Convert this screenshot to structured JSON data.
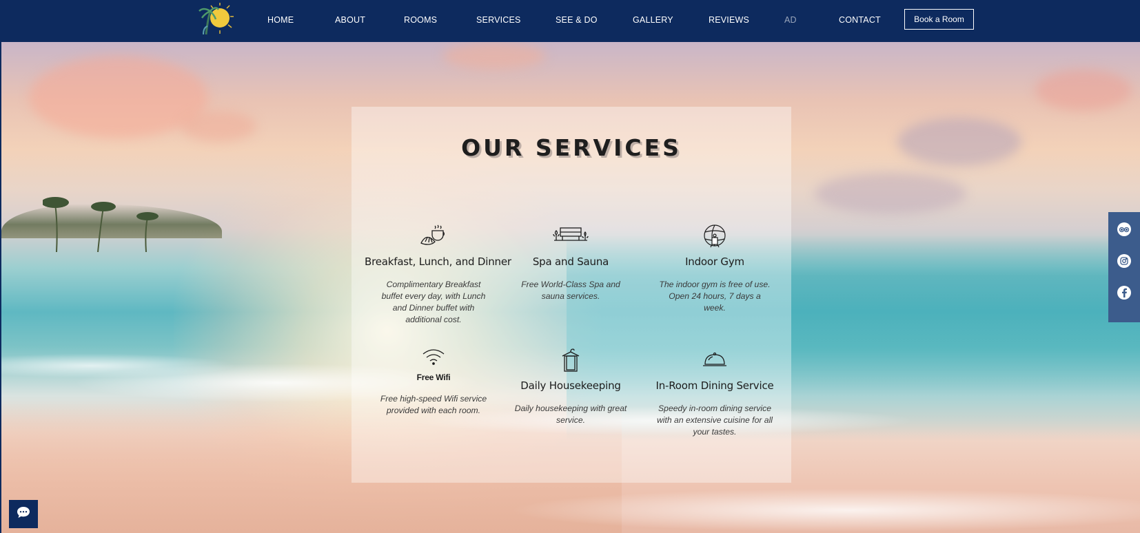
{
  "header": {
    "logo_alt": "Palms & Sun logo",
    "nav": [
      {
        "label": "HOME"
      },
      {
        "label": "ABOUT"
      },
      {
        "label": "ROOMS"
      },
      {
        "label": "SERVICES"
      },
      {
        "label": "SEE & DO"
      },
      {
        "label": "GALLERY"
      },
      {
        "label": "REVIEWS"
      },
      {
        "label": "AD"
      },
      {
        "label": "CONTACT"
      }
    ],
    "book_button": "Book a Room"
  },
  "main": {
    "title": "OUR SERVICES",
    "services": [
      {
        "icon": "coffee-croissant-icon",
        "title": "Breakfast, Lunch, and Dinner",
        "desc": "Complimentary Breakfast buffet every day, with Lunch and Dinner buffet with additional cost."
      },
      {
        "icon": "spa-bed-icon",
        "title": "Spa and Sauna",
        "desc": "Free World-Class Spa and sauna services."
      },
      {
        "icon": "gym-globe-icon",
        "title": "Indoor Gym",
        "desc": "The indoor gym is free of use. Open 24 hours, 7 days a week."
      },
      {
        "icon": "wifi-icon",
        "title": "Free Wifi",
        "desc": "Free high-speed Wifi service provided with each room."
      },
      {
        "icon": "towel-hanger-icon",
        "title": "Daily Housekeeping",
        "desc": "Daily housekeeping with great service."
      },
      {
        "icon": "room-service-cloche-icon",
        "title": "In-Room Dining Service",
        "desc": "Speedy in-room dining service with an extensive cuisine for all your tastes."
      }
    ]
  },
  "social": [
    {
      "icon": "tripadvisor-icon"
    },
    {
      "icon": "instagram-icon"
    },
    {
      "icon": "facebook-icon"
    }
  ],
  "chat": {
    "icon": "chat-bubble-icon"
  },
  "colors": {
    "header_bg": "#0d2a5e",
    "nav_text": "#ffffff",
    "nav_active": "#9aa6bb",
    "social_bg": "#3c5c8c"
  }
}
